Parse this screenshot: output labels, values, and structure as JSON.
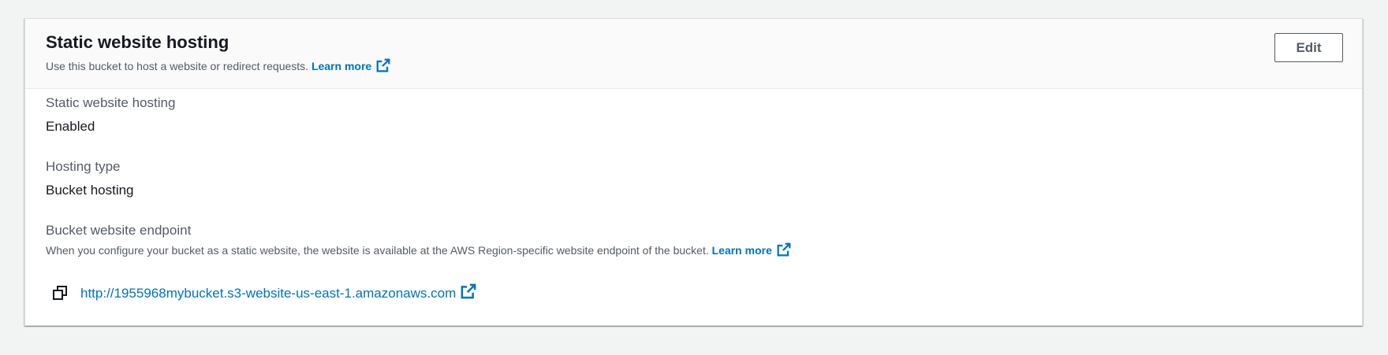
{
  "header": {
    "title": "Static website hosting",
    "description": "Use this bucket to host a website or redirect requests.",
    "learn_more": "Learn more",
    "edit_label": "Edit"
  },
  "fields": {
    "hosting": {
      "label": "Static website hosting",
      "value": "Enabled"
    },
    "hosting_type": {
      "label": "Hosting type",
      "value": "Bucket hosting"
    },
    "endpoint": {
      "label": "Bucket website endpoint",
      "description": "When you configure your bucket as a static website, the website is available at the AWS Region-specific website endpoint of the bucket.",
      "learn_more": "Learn more",
      "url": "http://1955968mybucket.s3-website-us-east-1.amazonaws.com"
    }
  },
  "icons": {
    "external_link": "external-link-icon",
    "copy": "copy-icon"
  },
  "colors": {
    "link": "#0073bb",
    "text": "#16191f",
    "secondary_text": "#545b64",
    "background": "#f2f3f3",
    "header_background": "#fafafa"
  }
}
